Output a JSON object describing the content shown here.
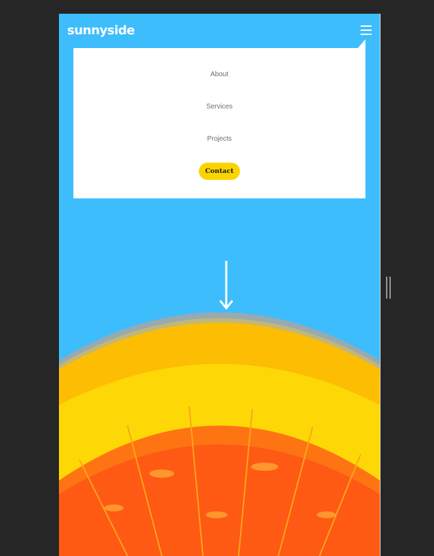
{
  "header": {
    "logo": "sunnyside",
    "menu_icon": "hamburger-icon"
  },
  "nav": {
    "items": [
      {
        "label": "About"
      },
      {
        "label": "Services"
      },
      {
        "label": "Projects"
      }
    ],
    "cta_label": "Contact"
  },
  "hero": {
    "image": "orange-slice-image",
    "arrow_icon": "arrow-down-icon"
  },
  "devtools": {
    "resize_handle": "viewport-resize-handle"
  },
  "colors": {
    "background": "#262626",
    "hero_blue": "#3ebdfd",
    "cta_yellow": "#fad400",
    "menu_text": "#6b6b7a",
    "orange": "#fe5a14"
  }
}
